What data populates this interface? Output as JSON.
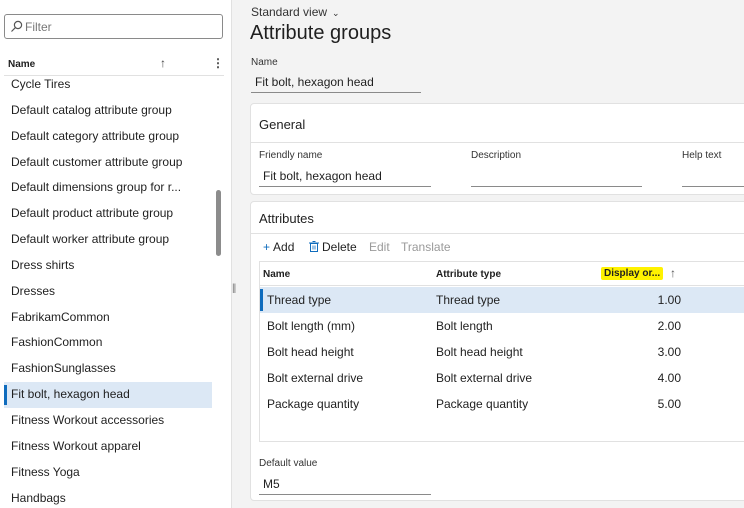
{
  "sidebar": {
    "filter_placeholder": "Filter",
    "column_header": "Name",
    "sort_arrow": "↑",
    "more_menu": "⋮",
    "items": [
      {
        "label": "Cycle Tires"
      },
      {
        "label": "Default catalog attribute group"
      },
      {
        "label": "Default category attribute group"
      },
      {
        "label": "Default customer attribute group"
      },
      {
        "label": "Default dimensions group for r..."
      },
      {
        "label": "Default product attribute group"
      },
      {
        "label": "Default worker attribute group"
      },
      {
        "label": "Dress shirts"
      },
      {
        "label": "Dresses"
      },
      {
        "label": "FabrikamCommon"
      },
      {
        "label": "FashionCommon"
      },
      {
        "label": "FashionSunglasses"
      },
      {
        "label": "Fit bolt, hexagon head",
        "selected": true
      },
      {
        "label": "Fitness Workout accessories"
      },
      {
        "label": "Fitness Workout apparel"
      },
      {
        "label": "Fitness Yoga"
      },
      {
        "label": "Handbags"
      }
    ]
  },
  "header": {
    "view_selector": "Standard view",
    "page_title": "Attribute groups",
    "name_label": "Name",
    "name_value": "Fit bolt, hexagon head"
  },
  "general": {
    "title": "General",
    "friendly_name_label": "Friendly name",
    "friendly_name_value": "Fit bolt, hexagon head",
    "description_label": "Description",
    "description_value": "",
    "help_text_label": "Help text",
    "help_text_value": ""
  },
  "attributes": {
    "title": "Attributes",
    "toolbar": {
      "add": "Add",
      "delete": "Delete",
      "edit": "Edit",
      "translate": "Translate"
    },
    "columns": {
      "name": "Name",
      "attribute_type": "Attribute type",
      "display_order": "Display or...",
      "sort_arrow": "↑"
    },
    "rows": [
      {
        "name": "Thread type",
        "type": "Thread type",
        "order": "1.00",
        "selected": true
      },
      {
        "name": "Bolt length (mm)",
        "type": "Bolt length",
        "order": "2.00"
      },
      {
        "name": "Bolt head height",
        "type": "Bolt head height",
        "order": "3.00"
      },
      {
        "name": "Bolt external drive",
        "type": "Bolt external drive",
        "order": "4.00"
      },
      {
        "name": "Package quantity",
        "type": "Package quantity",
        "order": "5.00"
      }
    ],
    "default_value_label": "Default value",
    "default_value": "M5"
  },
  "colors": {
    "accent": "#0f6cbd",
    "selection": "#dce8f5",
    "highlight": "#fff200"
  }
}
